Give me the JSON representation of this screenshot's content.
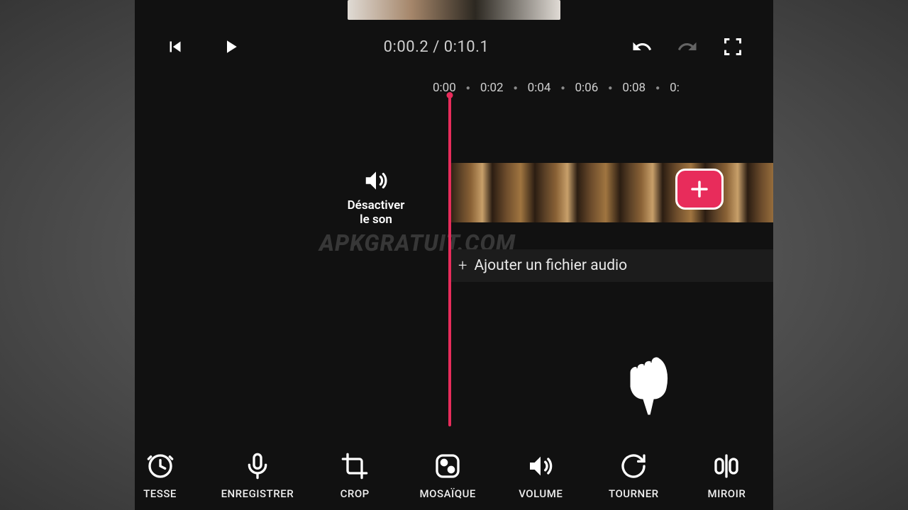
{
  "playback": {
    "current_time": "0:00.2",
    "total_time": "0:10.1",
    "separator": " / "
  },
  "ruler": {
    "ticks": [
      "0:00",
      "0:02",
      "0:04",
      "0:06",
      "0:08",
      "0:"
    ]
  },
  "mute": {
    "label": "Désactiver\nle son"
  },
  "audio_row": {
    "label": "Ajouter un fichier audio"
  },
  "watermark": "APKGRATUIT.COM",
  "toolbar": {
    "items": [
      {
        "key": "vitesse",
        "label": "TESSE",
        "icon": "speed-icon"
      },
      {
        "key": "enregistrer",
        "label": "ENREGISTRER",
        "icon": "microphone-icon"
      },
      {
        "key": "crop",
        "label": "CROP",
        "icon": "crop-icon"
      },
      {
        "key": "mosaique",
        "label": "MOSAÏQUE",
        "icon": "mosaic-icon"
      },
      {
        "key": "volume",
        "label": "VOLUME",
        "icon": "volume-icon"
      },
      {
        "key": "tourner",
        "label": "TOURNER",
        "icon": "rotate-icon"
      },
      {
        "key": "miroir",
        "label": "MIROIR",
        "icon": "mirror-icon"
      }
    ]
  },
  "colors": {
    "accent": "#e82c5b",
    "bg": "#111111",
    "text": "#efefef"
  }
}
